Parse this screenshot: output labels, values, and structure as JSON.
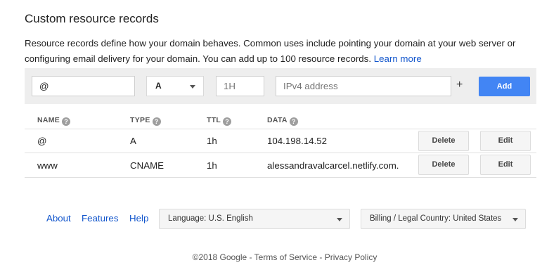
{
  "page": {
    "title": "Custom resource records",
    "description": "Resource records define how your domain behaves. Common uses include pointing your domain at your web server or configuring email delivery for your domain. You can add up to 100 resource records.",
    "learn_more": "Learn more"
  },
  "add_form": {
    "name_value": "@",
    "type_value": "A",
    "ttl_value": "1H",
    "data_placeholder": "IPv4 address",
    "plus": "+",
    "add_label": "Add"
  },
  "table": {
    "headers": [
      "NAME",
      "TYPE",
      "TTL",
      "DATA"
    ],
    "rows": [
      {
        "name": "@",
        "type": "A",
        "ttl": "1h",
        "data": "104.198.14.52",
        "delete": "Delete",
        "edit": "Edit"
      },
      {
        "name": "www",
        "type": "CNAME",
        "ttl": "1h",
        "data": "alessandravalcarcel.netlify.com.",
        "delete": "Delete",
        "edit": "Edit"
      }
    ]
  },
  "footer": {
    "links": [
      "About",
      "Features",
      "Help"
    ],
    "language": "Language: U.S. English",
    "country": "Billing / Legal Country: United States",
    "copyright": "©2018 Google",
    "sep": " - ",
    "terms": "Terms of Service",
    "privacy": "Privacy Policy"
  },
  "colors": {
    "accent": "#4285f4",
    "link": "#1155cc",
    "toolbar_bg": "#eeeeee"
  }
}
